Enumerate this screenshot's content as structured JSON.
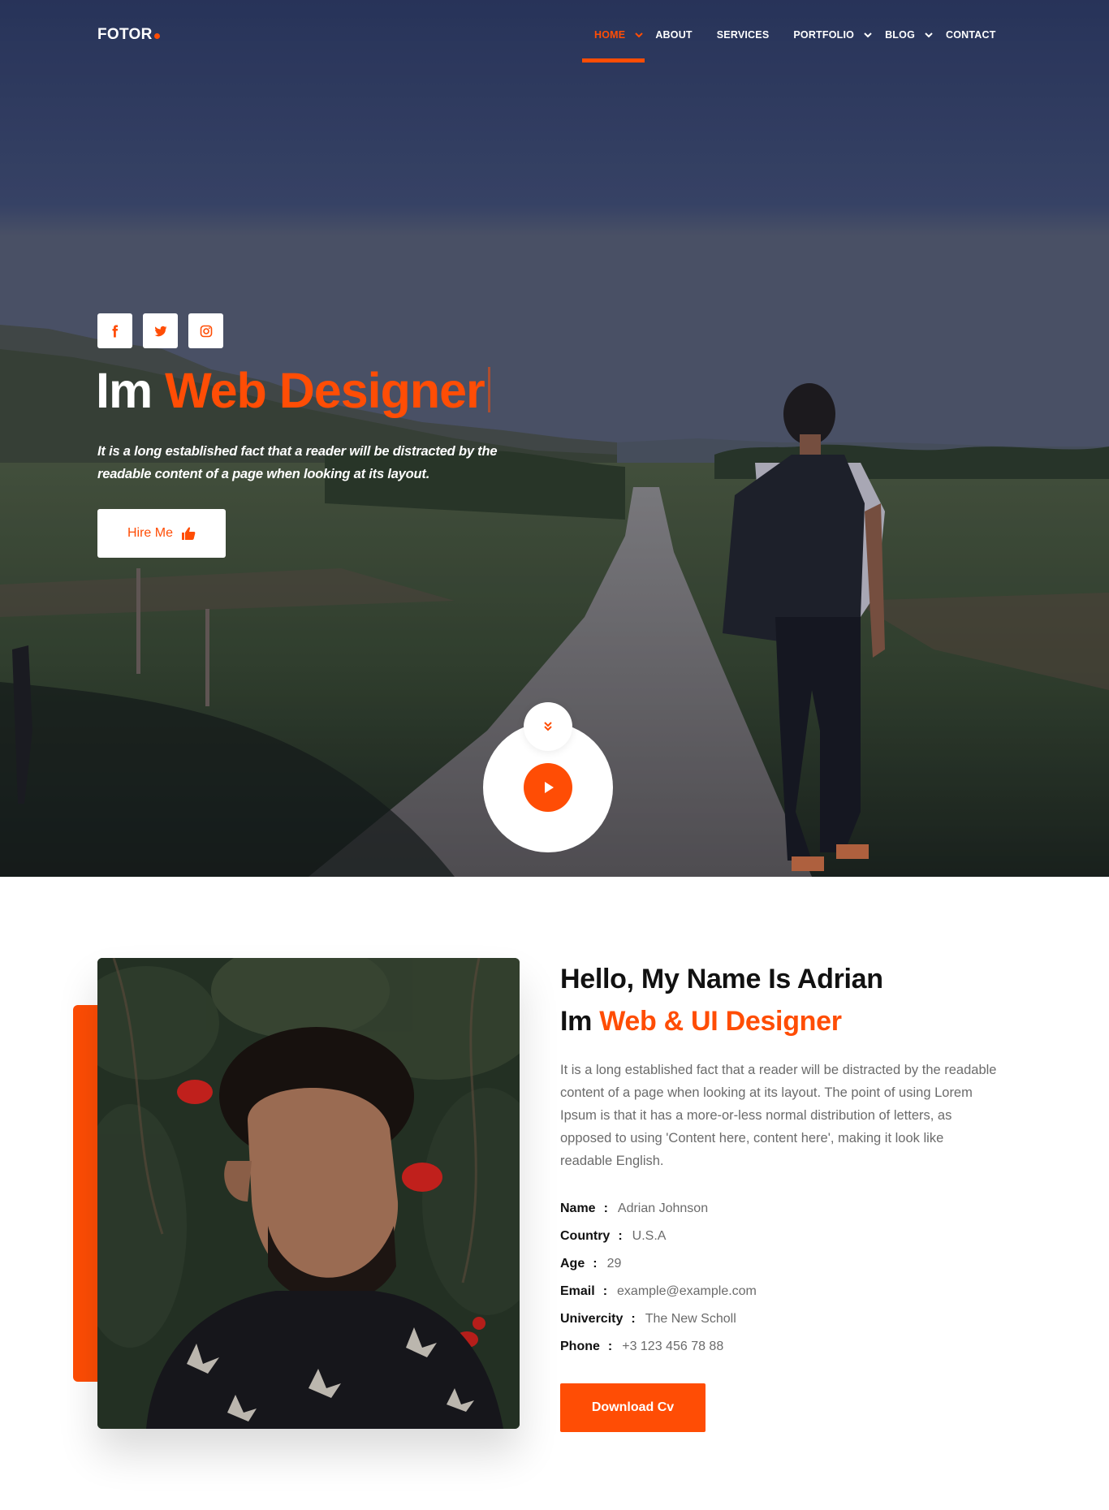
{
  "brand": {
    "name": "FOTOR",
    "accent": "#ff4d05"
  },
  "nav": {
    "items": [
      {
        "label": "HOME",
        "active": true,
        "dropdown": true
      },
      {
        "label": "ABOUT",
        "active": false,
        "dropdown": false
      },
      {
        "label": "SERVICES",
        "active": false,
        "dropdown": false
      },
      {
        "label": "PORTFOLIO",
        "active": false,
        "dropdown": true
      },
      {
        "label": "BLOG",
        "active": false,
        "dropdown": true
      },
      {
        "label": "CONTACT",
        "active": false,
        "dropdown": false
      }
    ]
  },
  "hero": {
    "social": [
      "facebook-icon",
      "twitter-icon",
      "instagram-icon"
    ],
    "title_prefix": "Im",
    "title_highlight": "Web Designer",
    "description": "It is a long established fact that a reader will be distracted by the readable content of a page when looking at its layout.",
    "hire_label": "Hire Me",
    "hire_icon": "thumbs-up-icon"
  },
  "about": {
    "heading": "Hello, My Name Is Adrian",
    "subheading_prefix": "Im",
    "subheading_highlight": "Web & UI Designer",
    "paragraph": "It is a long established fact that a reader will be distracted by the readable content of a page when looking at its layout. The point of using Lorem Ipsum is that it has a more-or-less normal distribution of letters, as opposed to using 'Content here, content here', making it look like readable English.",
    "info": [
      {
        "key": "Name",
        "value": "Adrian Johnson"
      },
      {
        "key": "Country",
        "value": "U.S.A"
      },
      {
        "key": "Age",
        "value": "29"
      },
      {
        "key": "Email",
        "value": "example@example.com"
      },
      {
        "key": "Univercity",
        "value": "The New Scholl"
      },
      {
        "key": "Phone",
        "value": "+3 123 456 78 88"
      }
    ],
    "download_label": "Download Cv"
  }
}
